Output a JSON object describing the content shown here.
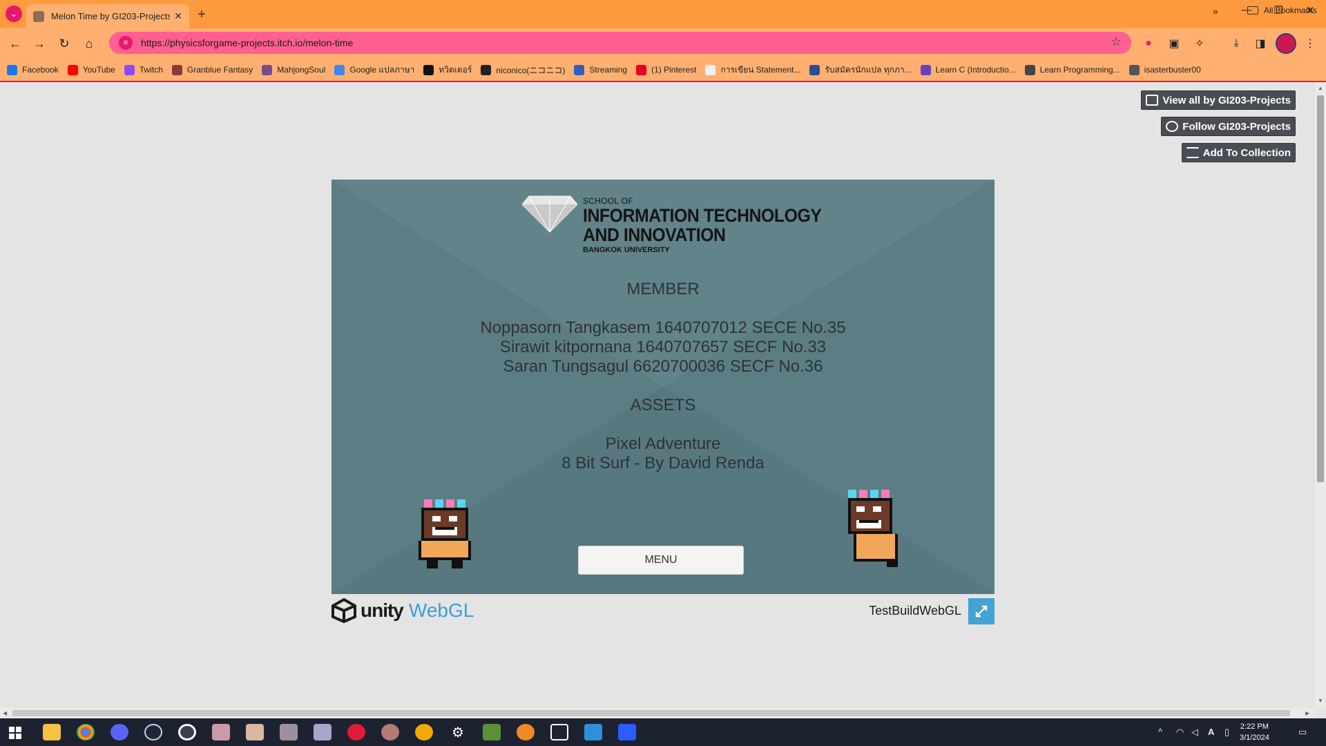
{
  "browser": {
    "tab_title": "Melon Time by GI203-Projects",
    "url": "https://physicsforgame-projects.itch.io/melon-time",
    "bookmarks": [
      {
        "label": "Facebook",
        "color": "#1877f2"
      },
      {
        "label": "YouTube",
        "color": "#ff0000"
      },
      {
        "label": "Twitch",
        "color": "#9146ff"
      },
      {
        "label": "Granblue Fantasy",
        "color": "#8b3a3a"
      },
      {
        "label": "MahjongSoul",
        "color": "#7a4b8c"
      },
      {
        "label": "Google แปลภาษา",
        "color": "#4285f4"
      },
      {
        "label": "ทวิตเตอร์",
        "color": "#111111"
      },
      {
        "label": "niconico(ニコニコ)",
        "color": "#222222"
      },
      {
        "label": "Streaming",
        "color": "#2f5fbf"
      },
      {
        "label": "(1) Pinterest",
        "color": "#e60023"
      },
      {
        "label": "การเขียน Statement...",
        "color": "#f0f0f0"
      },
      {
        "label": "รับสมัครนักแปล ทุกภา...",
        "color": "#2a4f8c"
      },
      {
        "label": "Learn C (Introductio...",
        "color": "#6a3fbf"
      },
      {
        "label": "Learn Programming...",
        "color": "#444444"
      },
      {
        "label": "isasterbuster00",
        "color": "#555555"
      }
    ],
    "all_bookmarks": "All Bookmarks"
  },
  "page": {
    "buttons": {
      "view_all": "View all by GI203-Projects",
      "follow": "Follow GI203-Projects",
      "add_collection": "Add To Collection"
    }
  },
  "game": {
    "logo": {
      "line1": "SCHOOL OF",
      "line2": "INFORMATION TECHNOLOGY",
      "line3": "AND INNOVATION",
      "line4": "BANGKOK UNIVERSITY"
    },
    "member_heading": "MEMBER",
    "members": [
      "Noppasorn Tangkasem 1640707012 SECE No.35",
      "Sirawit kitpornana 1640707657 SECF No.33",
      "Saran Tungsagul 6620700036 SECF No.36"
    ],
    "assets_heading": "ASSETS",
    "assets": [
      "Pixel Adventure",
      "8 Bit Surf - By David Renda"
    ],
    "menu_button": "MENU"
  },
  "unity": {
    "brand": "unity",
    "webgl": "WebGL",
    "build_title": "TestBuildWebGL"
  },
  "taskbar": {
    "time": "2:22 PM",
    "date": "3/1/2024"
  },
  "colors": {
    "tab_bar": "#ff9a3e",
    "toolbar": "#ffb070",
    "omnibox": "#ff5f93",
    "game_bg": "#5c7d84",
    "webgl_blue": "#3c9dd7"
  }
}
